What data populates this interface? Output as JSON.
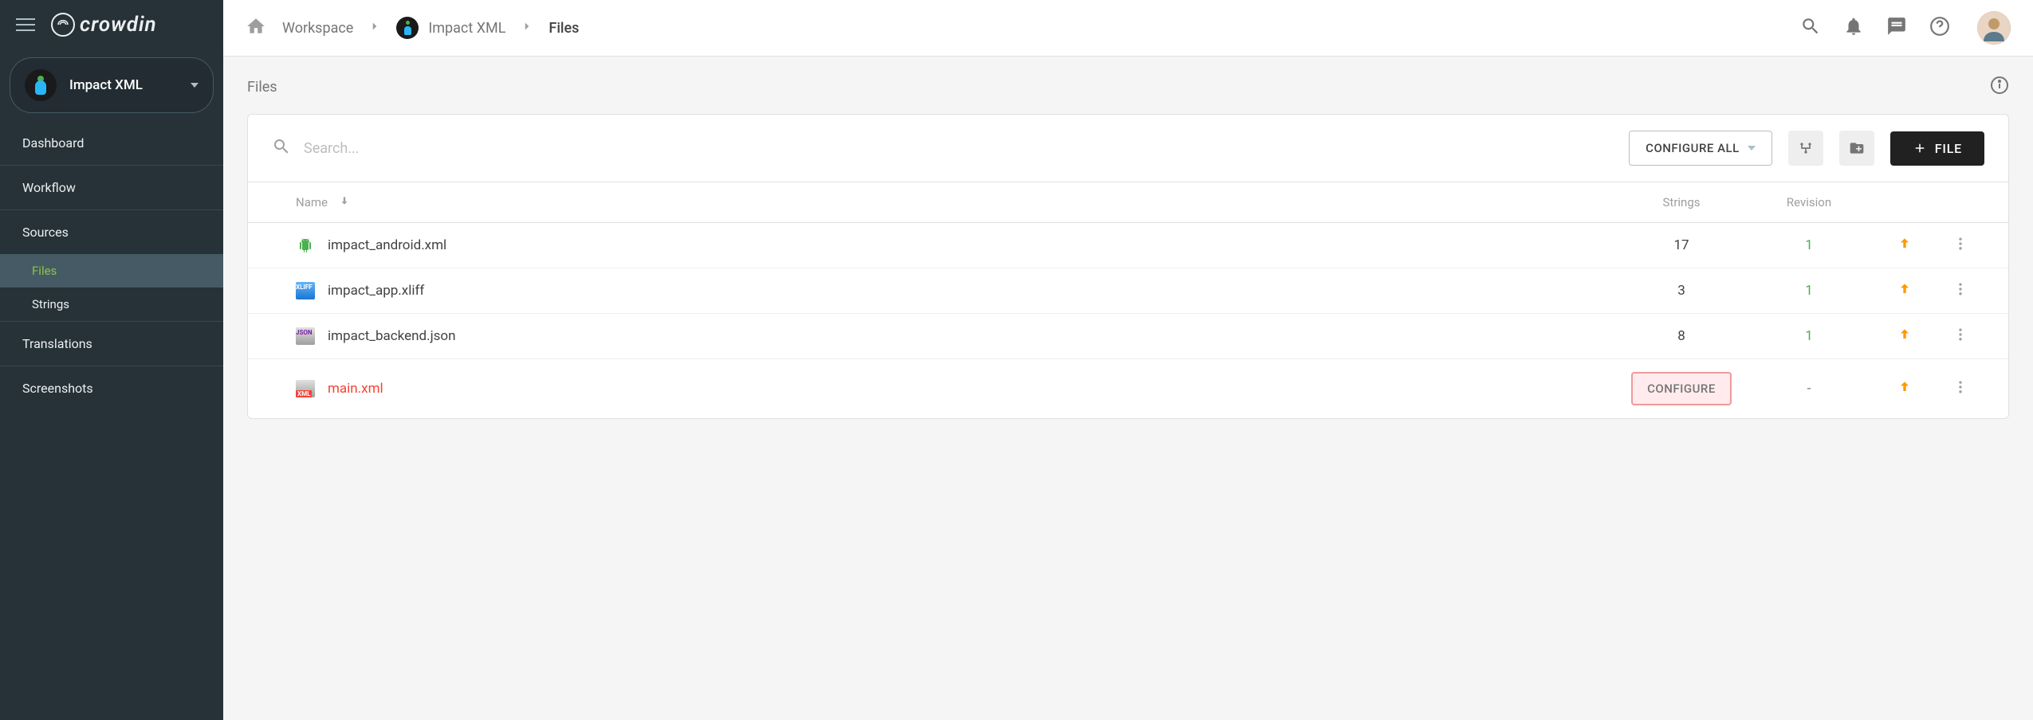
{
  "brand": "crowdin",
  "project_selector": {
    "name": "Impact XML"
  },
  "sidebar": {
    "items": [
      {
        "label": "Dashboard"
      },
      {
        "label": "Workflow"
      },
      {
        "label": "Sources"
      },
      {
        "label": "Translations"
      },
      {
        "label": "Screenshots"
      }
    ],
    "sources_sub": [
      {
        "label": "Files",
        "active": true
      },
      {
        "label": "Strings",
        "active": false
      }
    ]
  },
  "breadcrumbs": {
    "workspace": "Workspace",
    "project": "Impact XML",
    "page": "Files"
  },
  "page_title": "Files",
  "search": {
    "placeholder": "Search..."
  },
  "toolbar": {
    "configure_all": "CONFIGURE ALL",
    "file_button": "FILE"
  },
  "table": {
    "columns": {
      "name": "Name",
      "strings": "Strings",
      "revision": "Revision"
    },
    "rows": [
      {
        "icon": "android",
        "name": "impact_android.xml",
        "strings": "17",
        "revision": "1",
        "error": false
      },
      {
        "icon": "xliff",
        "name": "impact_app.xliff",
        "strings": "3",
        "revision": "1",
        "error": false
      },
      {
        "icon": "json",
        "name": "impact_backend.json",
        "strings": "8",
        "revision": "1",
        "error": false
      },
      {
        "icon": "xml",
        "name": "main.xml",
        "strings": null,
        "revision": "-",
        "error": true,
        "configure": "CONFIGURE"
      }
    ]
  }
}
